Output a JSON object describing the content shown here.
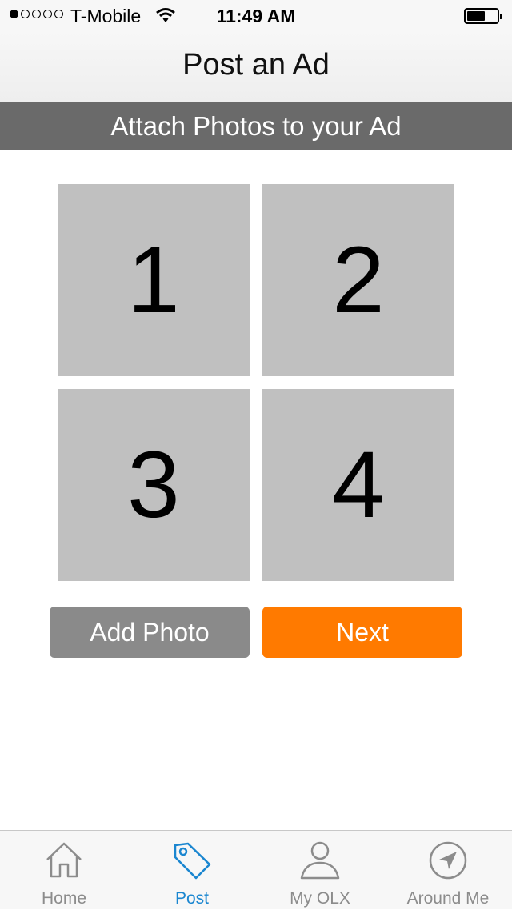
{
  "status_bar": {
    "carrier": "T-Mobile",
    "time": "11:49 AM",
    "signal_bars_filled": 1,
    "signal_bars_total": 5,
    "battery_level": 0.55
  },
  "nav": {
    "title": "Post an Ad"
  },
  "section": {
    "title": "Attach Photos to your Ad"
  },
  "photo_slots": [
    {
      "label": "1"
    },
    {
      "label": "2"
    },
    {
      "label": "3"
    },
    {
      "label": "4"
    }
  ],
  "actions": {
    "add_photo_label": "Add Photo",
    "next_label": "Next"
  },
  "tabs": [
    {
      "label": "Home",
      "icon": "home-icon",
      "active": false
    },
    {
      "label": "Post",
      "icon": "tag-icon",
      "active": true
    },
    {
      "label": "My OLX",
      "icon": "person-icon",
      "active": false
    },
    {
      "label": "Around Me",
      "icon": "compass-icon",
      "active": false
    }
  ],
  "colors": {
    "accent_orange": "#ff7a00",
    "tab_active": "#1a86d0",
    "section_header_bg": "#6a6a6a",
    "slot_bg": "#c0c0c0"
  }
}
